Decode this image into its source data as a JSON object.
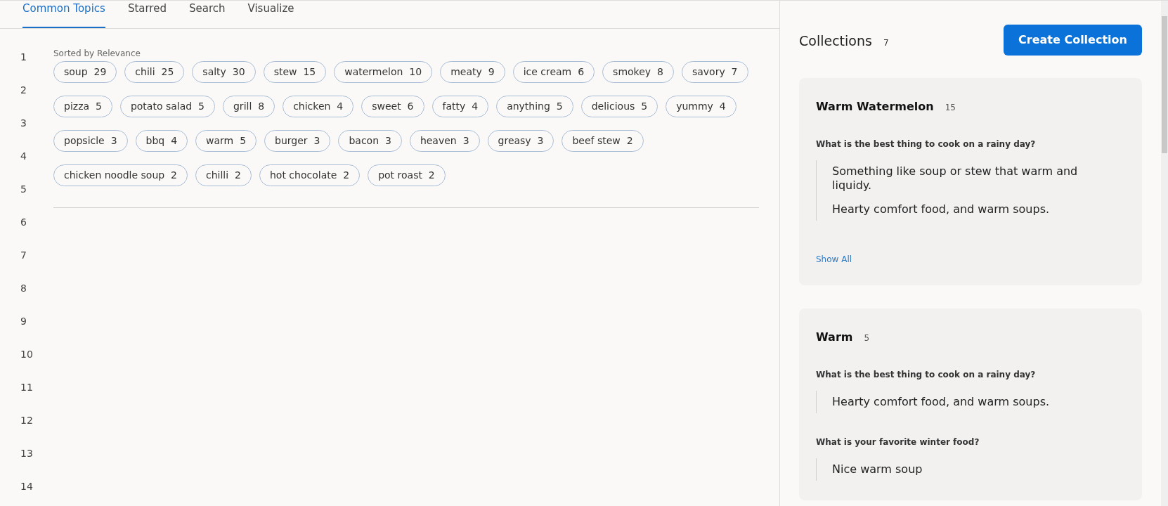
{
  "tabs": [
    {
      "label": "Common Topics",
      "selected": true
    },
    {
      "label": "Starred",
      "selected": false
    },
    {
      "label": "Search",
      "selected": false
    },
    {
      "label": "Visualize",
      "selected": false
    }
  ],
  "line_numbers": [
    "1",
    "2",
    "3",
    "4",
    "5",
    "6",
    "7",
    "8",
    "9",
    "10",
    "11",
    "12",
    "13",
    "14"
  ],
  "sort_label": "Sorted by Relevance",
  "topic_rows": [
    [
      {
        "label": "soup",
        "count": "29"
      },
      {
        "label": "chili",
        "count": "25"
      },
      {
        "label": "salty",
        "count": "30"
      },
      {
        "label": "stew",
        "count": "15"
      },
      {
        "label": "watermelon",
        "count": "10"
      },
      {
        "label": "meaty",
        "count": "9"
      },
      {
        "label": "ice cream",
        "count": "6"
      },
      {
        "label": "smokey",
        "count": "8"
      },
      {
        "label": "savory",
        "count": "7"
      }
    ],
    [
      {
        "label": "pizza",
        "count": "5"
      },
      {
        "label": "potato salad",
        "count": "5"
      },
      {
        "label": "grill",
        "count": "8"
      },
      {
        "label": "chicken",
        "count": "4"
      },
      {
        "label": "sweet",
        "count": "6"
      },
      {
        "label": "fatty",
        "count": "4"
      },
      {
        "label": "anything",
        "count": "5"
      },
      {
        "label": "delicious",
        "count": "5"
      },
      {
        "label": "yummy",
        "count": "4"
      }
    ],
    [
      {
        "label": "popsicle",
        "count": "3"
      },
      {
        "label": "bbq",
        "count": "4"
      },
      {
        "label": "warm",
        "count": "5"
      },
      {
        "label": "burger",
        "count": "3"
      },
      {
        "label": "bacon",
        "count": "3"
      },
      {
        "label": "heaven",
        "count": "3"
      },
      {
        "label": "greasy",
        "count": "3"
      },
      {
        "label": "beef stew",
        "count": "2"
      }
    ],
    [
      {
        "label": "chicken noodle soup",
        "count": "2"
      },
      {
        "label": "chilli",
        "count": "2"
      },
      {
        "label": "hot chocolate",
        "count": "2"
      },
      {
        "label": "pot roast",
        "count": "2"
      }
    ]
  ],
  "collections": {
    "title": "Collections",
    "count": "7",
    "create_button": "Create Collection",
    "cards": [
      {
        "title": "Warm Watermelon",
        "count": "15",
        "groups": [
          {
            "question": "What is the best thing to cook on a rainy day?",
            "answers": [
              "Something like soup or stew that warm and liquidy.",
              "Hearty comfort food, and warm soups."
            ]
          }
        ],
        "show_all": "Show All"
      },
      {
        "title": "Warm",
        "count": "5",
        "groups": [
          {
            "question": "What is the best thing to cook on a rainy day?",
            "answers": [
              "Hearty comfort food, and warm soups."
            ]
          },
          {
            "question": "What is your favorite winter food?",
            "answers": [
              "Nice warm soup"
            ]
          }
        ]
      }
    ]
  }
}
